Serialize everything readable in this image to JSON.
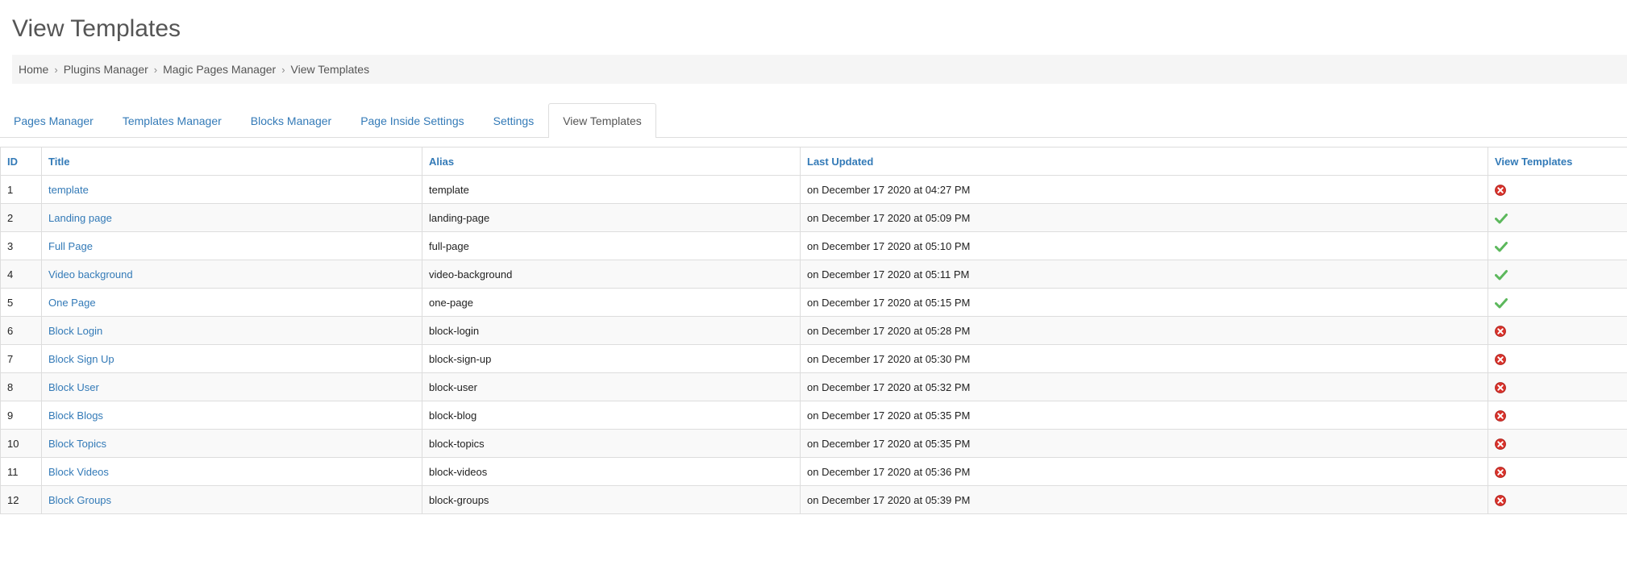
{
  "page": {
    "title": "View Templates"
  },
  "breadcrumb": [
    {
      "label": "Home"
    },
    {
      "label": "Plugins Manager"
    },
    {
      "label": "Magic Pages Manager"
    },
    {
      "label": "View Templates"
    }
  ],
  "tabs": [
    {
      "label": "Pages Manager",
      "active": false
    },
    {
      "label": "Templates Manager",
      "active": false
    },
    {
      "label": "Blocks Manager",
      "active": false
    },
    {
      "label": "Page Inside Settings",
      "active": false
    },
    {
      "label": "Settings",
      "active": false
    },
    {
      "label": "View Templates",
      "active": true
    }
  ],
  "table": {
    "headers": [
      "ID",
      "Title",
      "Alias",
      "Last Updated",
      "View Templates"
    ],
    "rows": [
      {
        "id": "1",
        "title": "template",
        "alias": "template",
        "updated": "on December 17 2020 at 04:27 PM",
        "status": "disabled-icon"
      },
      {
        "id": "2",
        "title": "Landing page",
        "alias": "landing-page",
        "updated": "on December 17 2020 at 05:09 PM",
        "status": "enabled-icon"
      },
      {
        "id": "3",
        "title": "Full Page",
        "alias": "full-page",
        "updated": "on December 17 2020 at 05:10 PM",
        "status": "enabled-icon"
      },
      {
        "id": "4",
        "title": "Video background",
        "alias": "video-background",
        "updated": "on December 17 2020 at 05:11 PM",
        "status": "enabled-icon"
      },
      {
        "id": "5",
        "title": "One Page",
        "alias": "one-page",
        "updated": "on December 17 2020 at 05:15 PM",
        "status": "enabled-icon"
      },
      {
        "id": "6",
        "title": "Block Login",
        "alias": "block-login",
        "updated": "on December 17 2020 at 05:28 PM",
        "status": "disabled-icon"
      },
      {
        "id": "7",
        "title": "Block Sign Up",
        "alias": "block-sign-up",
        "updated": "on December 17 2020 at 05:30 PM",
        "status": "disabled-icon"
      },
      {
        "id": "8",
        "title": "Block User",
        "alias": "block-user",
        "updated": "on December 17 2020 at 05:32 PM",
        "status": "disabled-icon"
      },
      {
        "id": "9",
        "title": "Block Blogs",
        "alias": "block-blog",
        "updated": "on December 17 2020 at 05:35 PM",
        "status": "disabled-icon"
      },
      {
        "id": "10",
        "title": "Block Topics",
        "alias": "block-topics",
        "updated": "on December 17 2020 at 05:35 PM",
        "status": "disabled-icon"
      },
      {
        "id": "11",
        "title": "Block Videos",
        "alias": "block-videos",
        "updated": "on December 17 2020 at 05:36 PM",
        "status": "disabled-icon"
      },
      {
        "id": "12",
        "title": "Block Groups",
        "alias": "block-groups",
        "updated": "on December 17 2020 at 05:39 PM",
        "status": "disabled-icon"
      }
    ]
  },
  "colors": {
    "link": "#337ab7",
    "enabled": "#5cb85c",
    "disabled": "#d9322b",
    "breadcrumb_bg": "#f5f5f5",
    "border": "#dddddd"
  }
}
